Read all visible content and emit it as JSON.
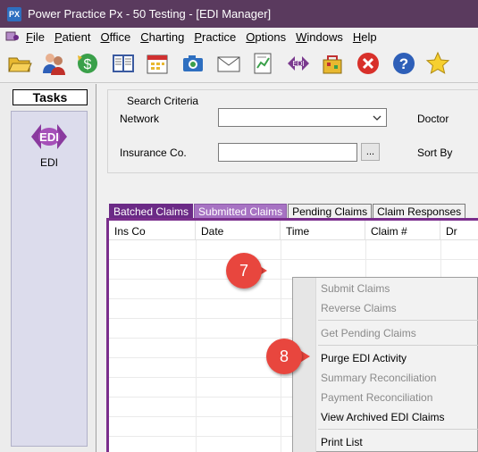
{
  "window": {
    "logo_text": "PX",
    "title": "Power Practice Px - 50 Testing - [EDI Manager]"
  },
  "menu": [
    "File",
    "Patient",
    "Office",
    "Charting",
    "Practice",
    "Options",
    "Windows",
    "Help"
  ],
  "toolbar": {
    "icons": [
      "open-folder-icon",
      "patients-icon",
      "money-icon",
      "book-icon",
      "calendar-icon",
      "camera-icon",
      "mail-icon",
      "report-icon",
      "edi-icon",
      "gift-bag-icon",
      "close-icon",
      "help-icon",
      "star-icon"
    ]
  },
  "sidebar": {
    "tasks_label": "Tasks",
    "edi_icon_text": "EDI",
    "edi_label": "EDI"
  },
  "search": {
    "legend": "Search Criteria",
    "network_label": "Network",
    "network_value": "",
    "insurance_label": "Insurance Co.",
    "insurance_value": "",
    "ellipsis": "...",
    "doctor_label": "Doctor",
    "sort_by_label": "Sort By"
  },
  "tabs": [
    "Batched Claims",
    "Submitted Claims",
    "Pending Claims",
    "Claim Responses"
  ],
  "grid": {
    "columns": [
      "Ins Co",
      "Date",
      "Time",
      "Claim #",
      "Dr"
    ]
  },
  "context_menu": {
    "items": [
      {
        "label": "Submit Claims",
        "enabled": false
      },
      {
        "label": "Reverse Claims",
        "enabled": false
      },
      {
        "label": "Get Pending Claims",
        "enabled": false
      },
      {
        "label": "Purge EDI Activity",
        "enabled": true
      },
      {
        "label": "Summary Reconciliation",
        "enabled": false
      },
      {
        "label": "Payment Reconciliation",
        "enabled": false
      },
      {
        "label": "View Archived EDI Claims",
        "enabled": true
      },
      {
        "label": "Print List",
        "enabled": true
      }
    ]
  },
  "callouts": {
    "step_7": "7",
    "step_8": "8"
  },
  "colors": {
    "titlebar": "#5a3a5e",
    "tab_active": "#6b2a86",
    "tab_submitted": "#a773c3",
    "grid_border": "#7a2e8c",
    "callout": "#e8463e"
  }
}
